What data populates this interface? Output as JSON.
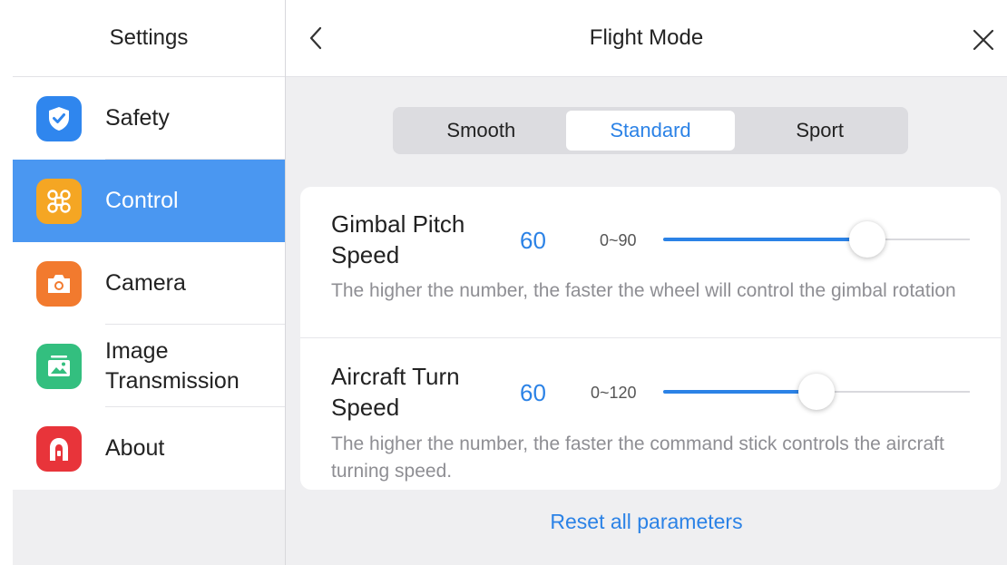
{
  "sidebar": {
    "title": "Settings",
    "items": [
      {
        "label": "Safety",
        "icon": "shield-check-icon",
        "color": "#2f86ee"
      },
      {
        "label": "Control",
        "icon": "drone-icon",
        "color": "#f5a623",
        "active": true
      },
      {
        "label": "Camera",
        "icon": "camera-icon",
        "color": "#f27a2e"
      },
      {
        "label_line1": "Image",
        "label_line2": "Transmission",
        "icon": "image-icon",
        "color": "#33bf7f"
      },
      {
        "label": "About",
        "icon": "brand-logo-icon",
        "color": "#e8343a"
      }
    ]
  },
  "header": {
    "title": "Flight Mode"
  },
  "modes": {
    "options": [
      "Smooth",
      "Standard",
      "Sport"
    ],
    "selected": "Standard"
  },
  "settings": [
    {
      "title_line1": "Gimbal Pitch",
      "title_line2": "Speed",
      "value": "60",
      "range": "0~90",
      "min": 0,
      "max": 90,
      "current": 60,
      "description": "The higher the number, the faster the wheel will control the gimbal rotation"
    },
    {
      "title_line1": "Aircraft Turn",
      "title_line2": "Speed",
      "value": "60",
      "range": "0~120",
      "min": 0,
      "max": 120,
      "current": 60,
      "description": "The higher the number, the faster the command stick controls the aircraft turning speed."
    }
  ],
  "reset_label": "Reset all parameters",
  "colors": {
    "accent": "#2b82e6",
    "active_sidebar": "#4a97f1"
  }
}
